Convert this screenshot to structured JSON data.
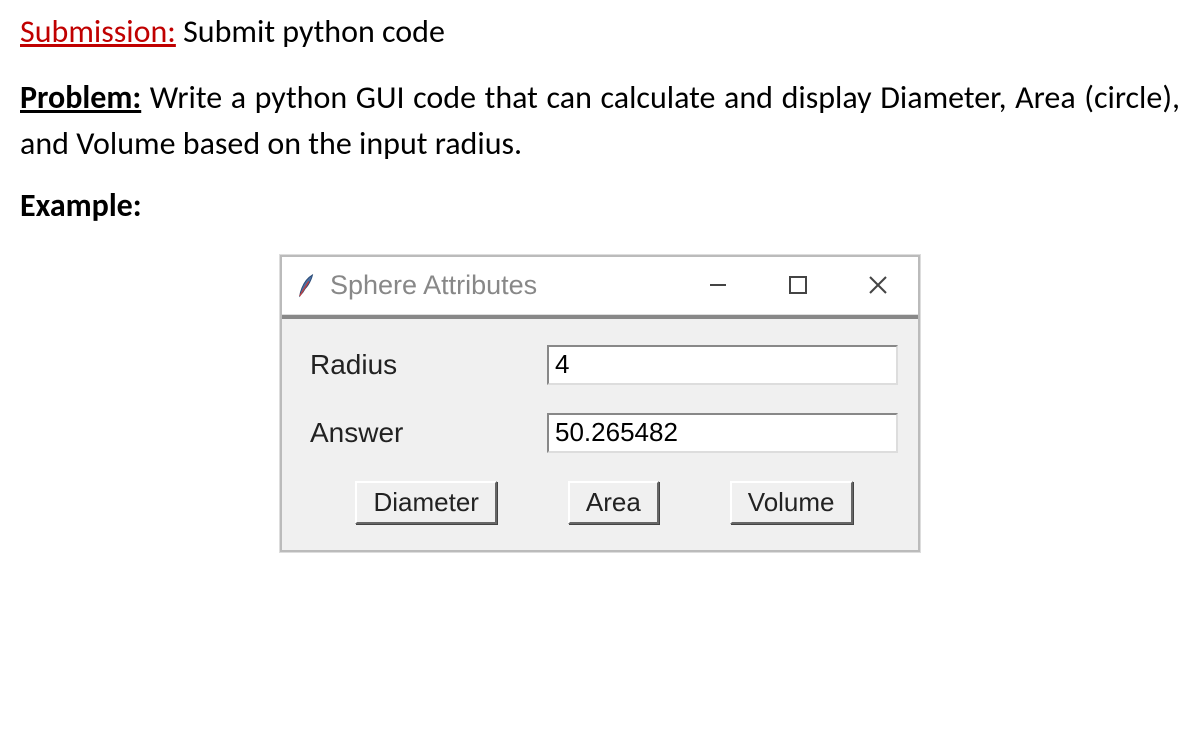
{
  "submission": {
    "label": "Submission:",
    "text": " Submit python code"
  },
  "problem": {
    "label": "Problem:",
    "text": " Write a python GUI code that can calculate and display Diameter, Area (circle), and Volume based on the input radius."
  },
  "example": {
    "label": "Example:"
  },
  "window": {
    "title": "Sphere Attributes",
    "fields": {
      "radius": {
        "label": "Radius",
        "value": "4"
      },
      "answer": {
        "label": "Answer",
        "value": "50.265482"
      }
    },
    "buttons": {
      "diameter": "Diameter",
      "area": "Area",
      "volume": "Volume"
    }
  }
}
